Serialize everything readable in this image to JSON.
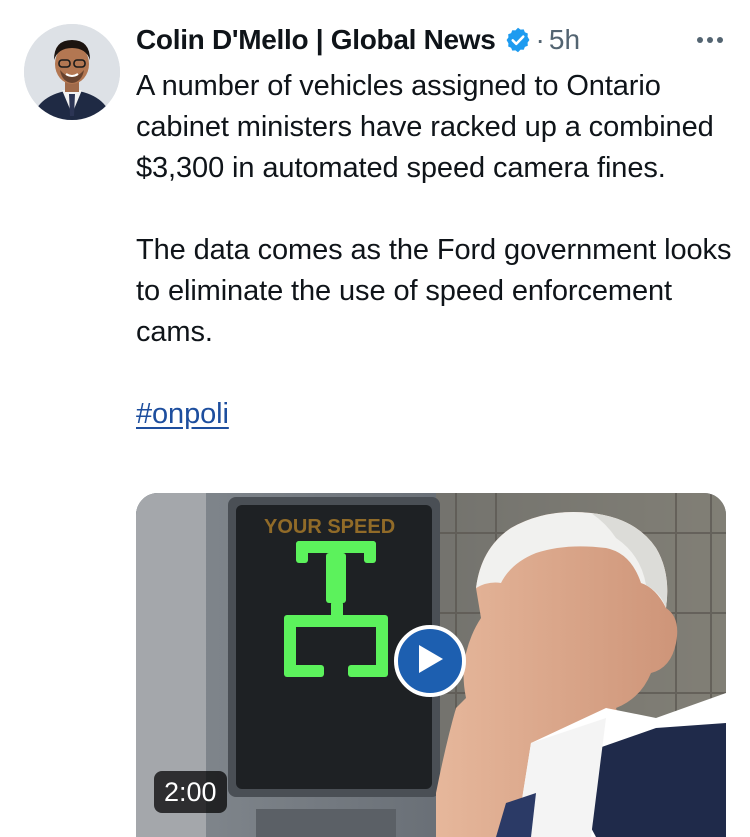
{
  "tweet": {
    "author_name": "Colin D'Mello | Global News",
    "verified_icon": "verified-badge-icon",
    "separator": "·",
    "time": "5h",
    "more_icon": "more-options-icon",
    "paragraph_1": "A number of vehicles assigned to Ontario cabinet ministers have racked up a combined $3,300 in automated speed camera fines.",
    "paragraph_2": "The data comes as the Ford government looks to eliminate the use of speed enforcement cams.",
    "hashtag": "#onpoli"
  },
  "media": {
    "type": "video",
    "sign_text": "YOUR SPEED",
    "display_value": "25",
    "play_icon": "play-icon",
    "duration": "2:00"
  },
  "colors": {
    "text": "#0f1419",
    "secondary": "#536471",
    "link": "#1d4e9e",
    "verified": "#1d9bf0",
    "play_button": "#1d5fb0",
    "led": "#5cf25c"
  }
}
